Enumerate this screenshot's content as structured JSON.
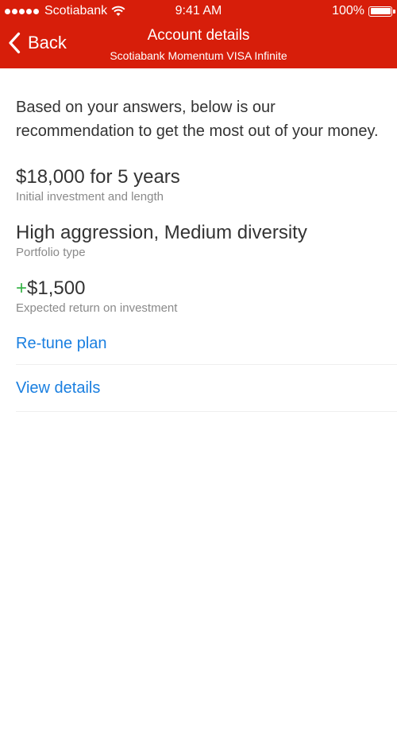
{
  "status_bar": {
    "carrier": "Scotiabank",
    "time": "9:41 AM",
    "battery": "100%"
  },
  "nav": {
    "back_label": "Back",
    "title": "Account details",
    "subtitle": "Scotiabank Momentum VISA Infinite"
  },
  "intro": "Based on your answers, below is our recommendation to get the most out of your money.",
  "details": {
    "investment_value": "$18,000 for 5 years",
    "investment_caption": "Initial investment and length",
    "portfolio_value": "High aggression, Medium diversity",
    "portfolio_caption": "Portfolio type",
    "return_sign": "+",
    "return_value": "$1,500",
    "return_caption": "Expected return on investment"
  },
  "actions": {
    "retune_label": "Re-tune plan",
    "view_details_label": "View details"
  },
  "colors": {
    "header_background": "#d71e0a",
    "link": "#1a7fe0",
    "positive": "#3ab44a"
  }
}
